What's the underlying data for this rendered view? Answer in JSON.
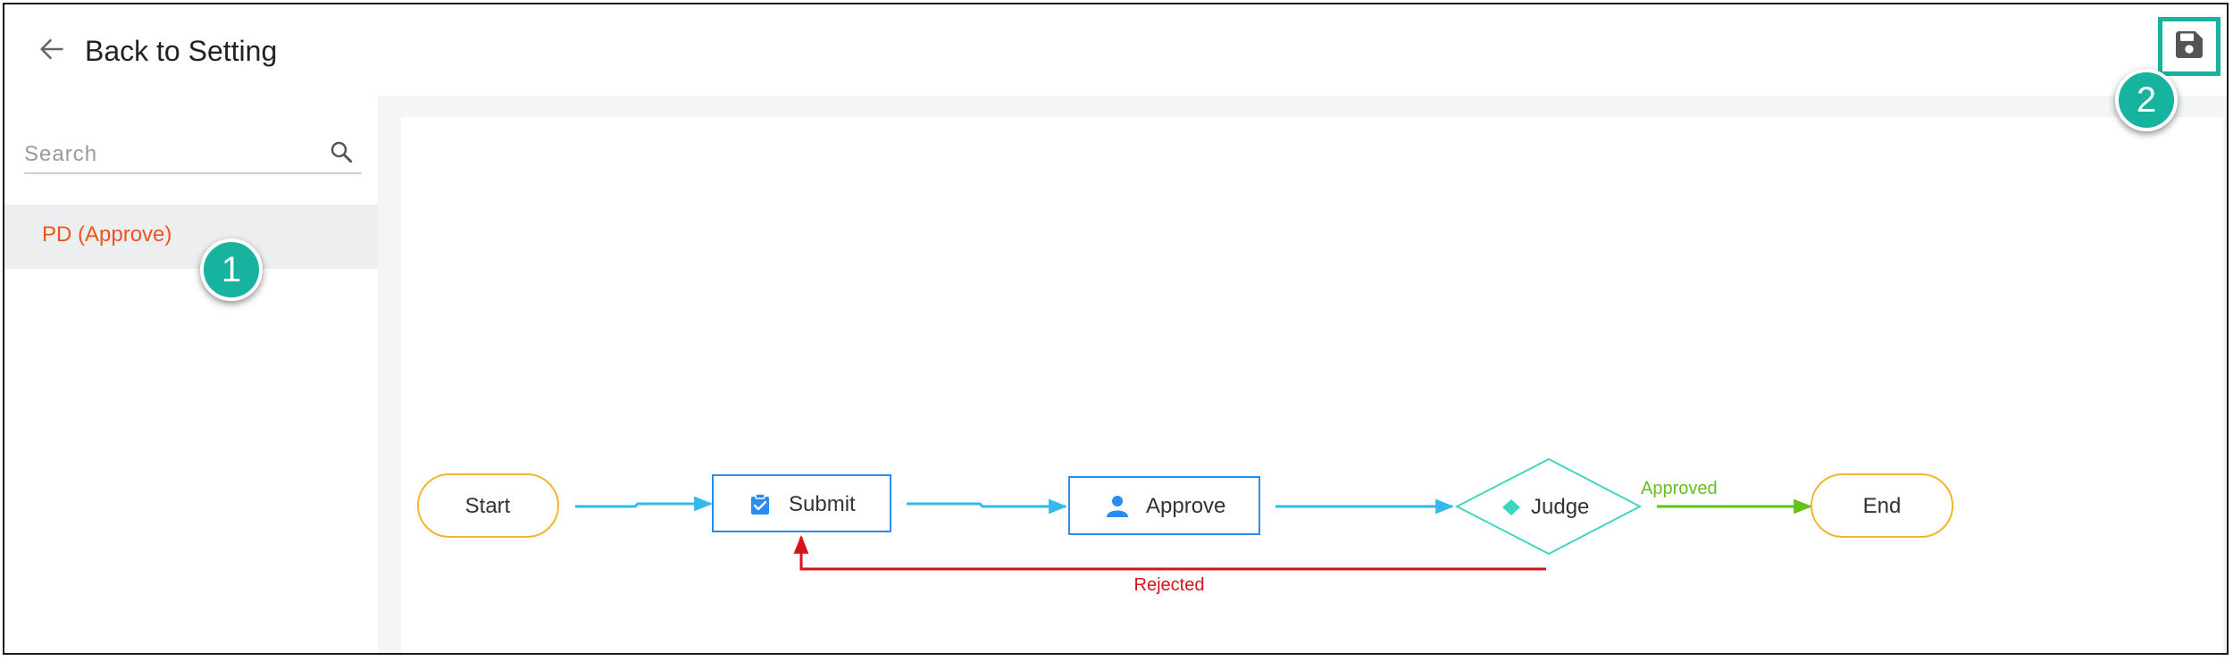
{
  "header": {
    "back_label": "Back to Setting"
  },
  "sidebar": {
    "search_placeholder": "Search",
    "items": [
      {
        "label": "PD (Approve)"
      }
    ]
  },
  "callouts": {
    "one": "1",
    "two": "2"
  },
  "flow": {
    "nodes": {
      "start": "Start",
      "submit": "Submit",
      "approve": "Approve",
      "judge": "Judge",
      "end": "End"
    },
    "edges": {
      "approved": "Approved",
      "rejected": "Rejected"
    }
  },
  "colors": {
    "accent": "#17b39f",
    "selected_text": "#f0521c",
    "start_end_border": "#f3b42e",
    "task_border": "#2a8cf0",
    "judge_border": "#3fd6c0",
    "edge_default": "#35b8ec",
    "edge_approved": "#63c21a",
    "edge_rejected": "#d6121b"
  },
  "icons": {
    "back": "arrow-left-icon",
    "save": "floppy-disk-icon",
    "search": "magnifier-icon",
    "submit_node": "clipboard-check-icon",
    "approve_node": "person-icon",
    "judge_node": "diamond-icon"
  }
}
